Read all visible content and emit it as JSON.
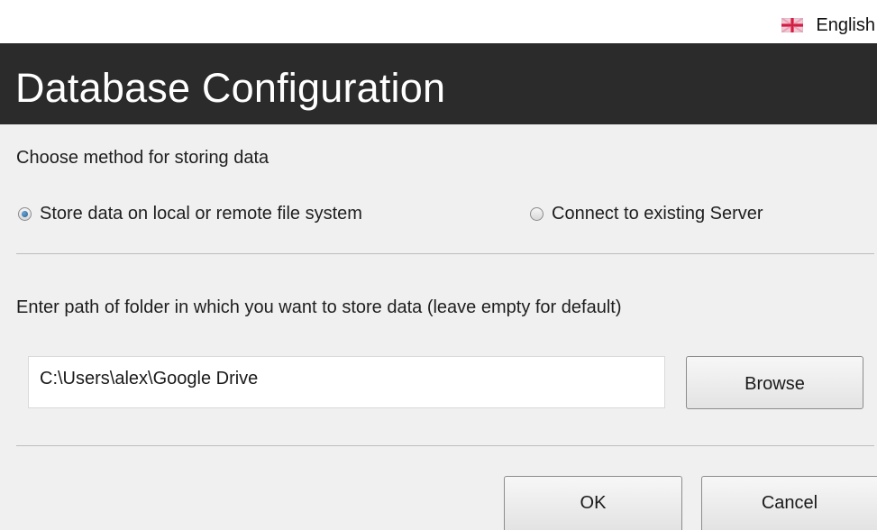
{
  "language": {
    "label": "English",
    "flag_icon": "uk-flag-icon"
  },
  "header": {
    "title": "Database Configuration"
  },
  "storage": {
    "prompt": "Choose method for storing data",
    "options": [
      {
        "label": "Store data on local or remote file system",
        "selected": true
      },
      {
        "label": "Connect to existing Server",
        "selected": false
      }
    ]
  },
  "path": {
    "prompt": "Enter path of folder in which you want to store data (leave empty for default)",
    "value": "C:\\Users\\alex\\Google Drive",
    "browse_label": "Browse"
  },
  "actions": {
    "ok_label": "OK",
    "cancel_label": "Cancel"
  },
  "colors": {
    "header_bg": "#2b2b2b",
    "body_bg": "#f0f0f0",
    "radio_selected": "#1f5f9c"
  }
}
